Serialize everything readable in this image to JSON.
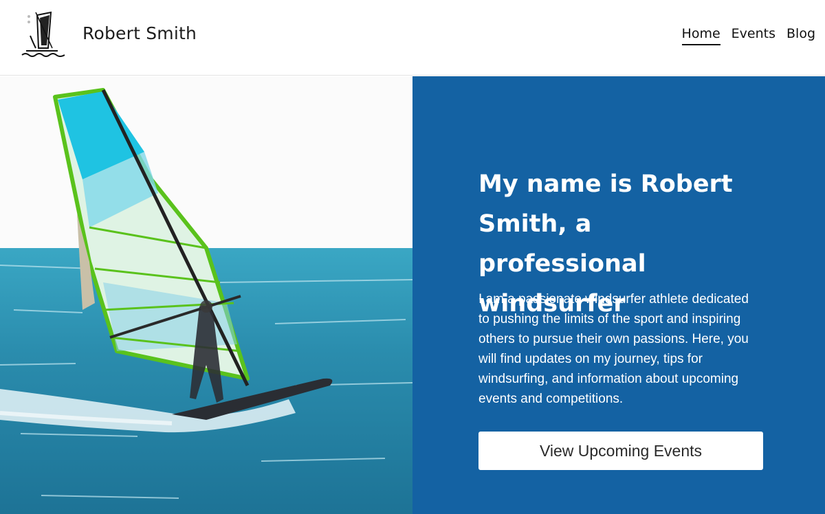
{
  "header": {
    "site_title": "Robert Smith",
    "logo_icon": "windsurfer-logo-icon",
    "nav": [
      {
        "label": "Home",
        "active": true
      },
      {
        "label": "Events",
        "active": false
      },
      {
        "label": "Blog",
        "active": false
      }
    ]
  },
  "hero": {
    "image_subject": "windsurfer-photo",
    "heading": "My name is Robert Smith, a professional windsurfer",
    "text": "I am a passionate windsurfer athlete dedicated to pushing the limits of the sport and inspiring others to pursue their own passions. Here, you will find updates on my journey, tips for windsurfing, and information about upcoming events and competitions.",
    "cta_label": "View Upcoming Events"
  },
  "colors": {
    "panel_blue": "#1462a3",
    "white": "#ffffff",
    "sail_green": "#7cd321",
    "sail_cyan": "#1fc3e2",
    "sea_blue": "#2b8fb0"
  }
}
